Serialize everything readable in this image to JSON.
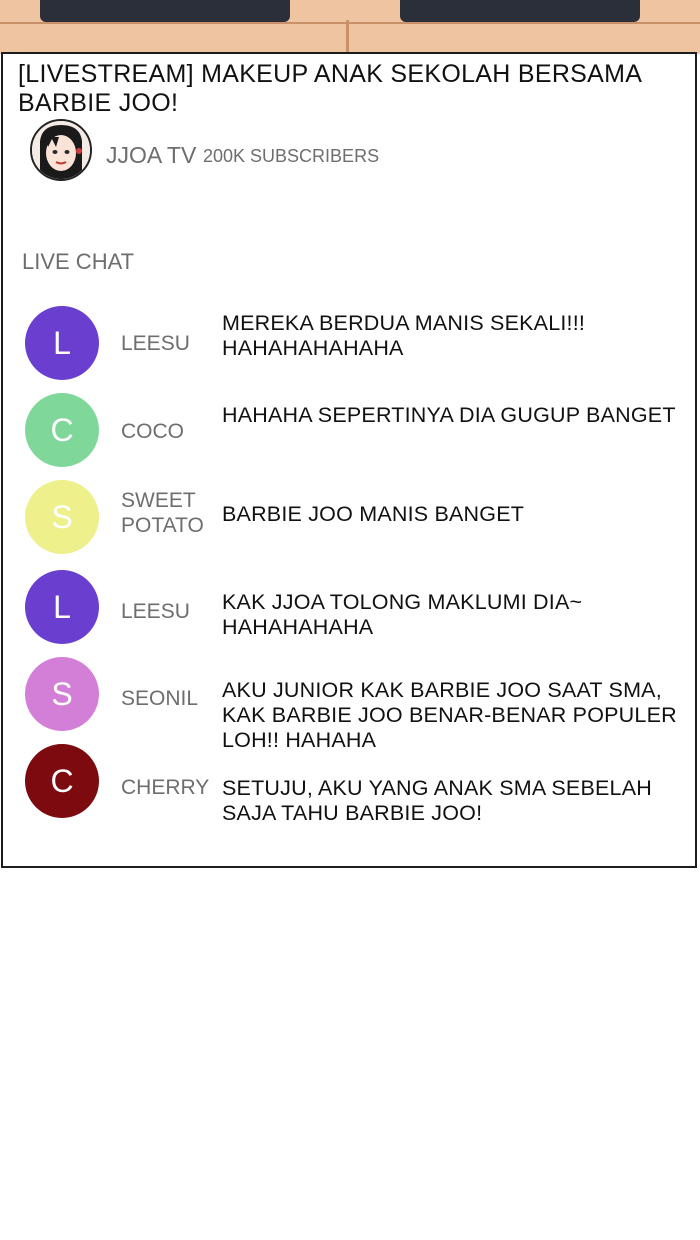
{
  "stream": {
    "title": "[LIVESTREAM] MAKEUP ANAK SEKOLAH BERSAMA BARBIE JOO!",
    "channel_name": "JJOA TV",
    "subscribers": "200K SUBSCRIBERS"
  },
  "live_chat": {
    "label": "LIVE CHAT",
    "messages": [
      {
        "initial": "L",
        "user": "LEESU",
        "text": "MEREKA BERDUA MANIS SEKALI!!! HAHAHAHAHAHA",
        "color": "#6a3fcf"
      },
      {
        "initial": "C",
        "user": "COCO",
        "text": "HAHAHA SEPERTINYA DIA GUGUP BANGET",
        "color": "#7fd89a"
      },
      {
        "initial": "S",
        "user": "SWEET POTATO",
        "text": "BARBIE JOO MANIS BANGET",
        "color": "#eef08c"
      },
      {
        "initial": "L",
        "user": "LEESU",
        "text": "KAK JJOA TOLONG MAKLUMI DIA~ HAHAHAHAHA",
        "color": "#6a3fcf"
      },
      {
        "initial": "S",
        "user": "SEONIL",
        "text": "AKU JUNIOR KAK BARBIE JOO SAAT SMA, KAK BARBIE JOO BENAR-BENAR POPULER LOH!! HAHAHA",
        "color": "#d37fd8"
      },
      {
        "initial": "C",
        "user": "CHERRY",
        "text": "SETUJU, AKU YANG ANAK SMA SEBELAH SAJA TAHU BARBIE JOO!",
        "color": "#7d0a0e"
      }
    ]
  }
}
